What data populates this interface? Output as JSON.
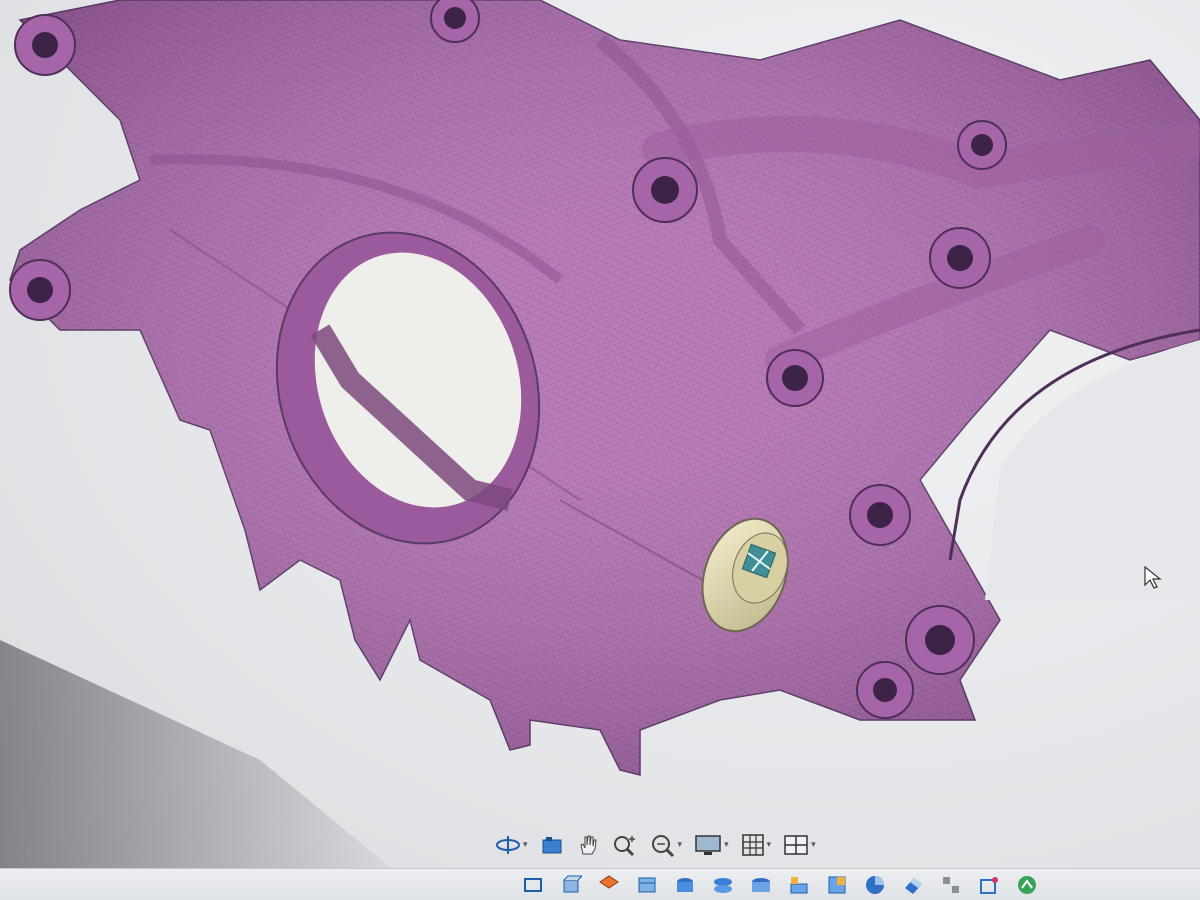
{
  "viewport": {
    "model_color": "#b66fb3",
    "mesh_color": "#5a3a66",
    "background": "#e9eaed",
    "plug_color": "#e8dfb0"
  },
  "view_toolbar": {
    "items": [
      {
        "name": "orbit-icon",
        "has_dropdown": true
      },
      {
        "name": "look-at-icon",
        "has_dropdown": false
      },
      {
        "name": "pan-hand-icon",
        "has_dropdown": false
      },
      {
        "name": "zoom-icon",
        "has_dropdown": false
      },
      {
        "name": "fit-zoom-icon",
        "has_dropdown": true
      },
      {
        "name": "display-settings-icon",
        "has_dropdown": true
      },
      {
        "name": "grid-icon",
        "has_dropdown": true
      },
      {
        "name": "viewports-icon",
        "has_dropdown": true
      }
    ],
    "accent": "#1a5fa8"
  },
  "command_bar": {
    "icons": [
      "sketch-icon",
      "extrude-icon",
      "box-icon",
      "cylinder-icon",
      "torus-icon",
      "revolve-icon",
      "hole-icon",
      "inspect-icon",
      "sphere-icon",
      "shell-icon",
      "combine-icon",
      "align-icon",
      "select-icon",
      "more-icon"
    ]
  }
}
